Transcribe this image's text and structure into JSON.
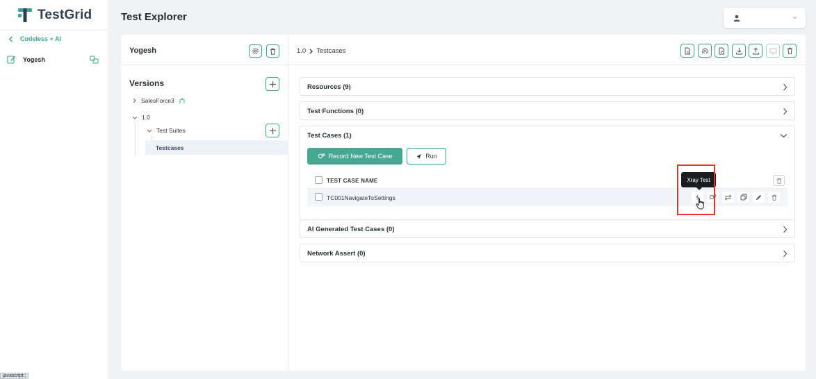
{
  "app": {
    "name": "TestGrid"
  },
  "leftnav": {
    "back_label": "Codeless + AI",
    "user_label": "Yogesh"
  },
  "header": {
    "title": "Test Explorer",
    "profile_name": ""
  },
  "left_pane": {
    "title": "Yogesh",
    "versions_label": "Versions",
    "tree": {
      "project": "SalesForce3",
      "version": "1.0",
      "suites_label": "Test Suites",
      "selected": "Testcases"
    }
  },
  "right_pane": {
    "breadcrumb": {
      "version": "1.0",
      "current": "Testcases"
    },
    "sections": {
      "resources": "Resources (9)",
      "test_functions": "Test Functions (0)",
      "test_cases": "Test Cases (1)",
      "ai_generated": "AI Generated Test Cases (0)",
      "network_assert": "Network Assert (0)"
    },
    "record_button": "Record New Test Case",
    "run_button": "Run",
    "table": {
      "column_name": "TEST CASE NAME",
      "rows": [
        {
          "name": "TC001NavigateToSettings"
        }
      ]
    },
    "tooltip": "Xray Test"
  },
  "status_bar": {
    "text": "javascript:;"
  },
  "colors": {
    "accent": "#3aa58c",
    "primary_button": "#46a893",
    "highlight": "#e1352d"
  }
}
